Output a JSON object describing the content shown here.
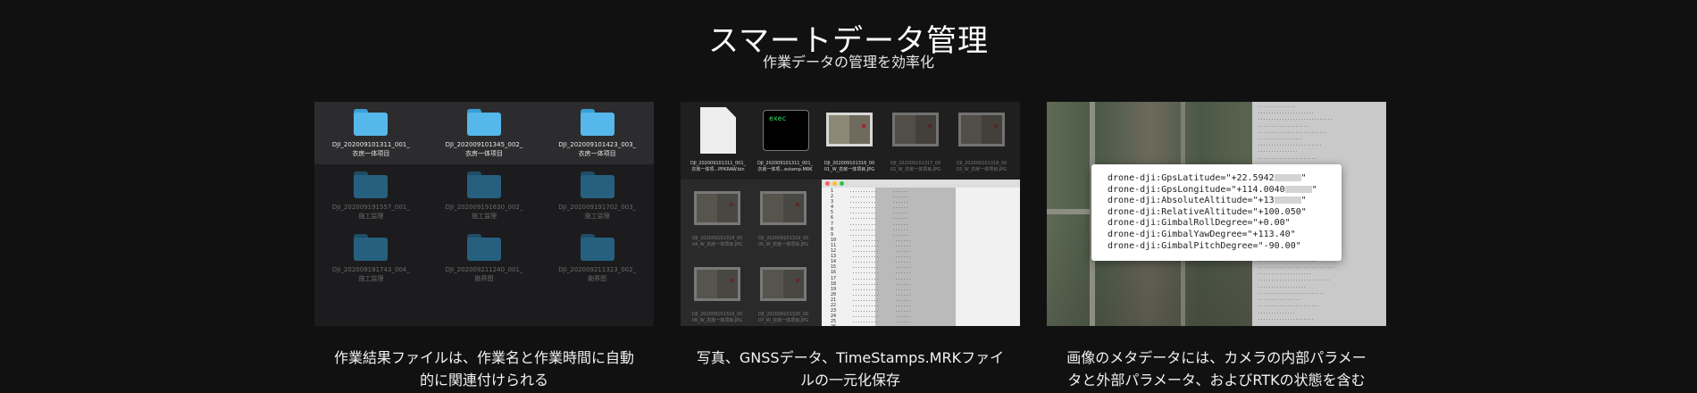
{
  "header": {
    "title": "スマートデータ管理",
    "subtitle": "作業データの管理を効率化"
  },
  "features": [
    {
      "caption_line1": "作業結果ファイルは、作業名と作業時間に自動",
      "caption_line2": "的に関連付けられる",
      "folders": [
        {
          "name1": "DJI_202009101311_001_",
          "name2": "衣房一体项目"
        },
        {
          "name1": "DJI_202009101345_002_",
          "name2": "衣房一体项目"
        },
        {
          "name1": "DJI_202009101423_003_",
          "name2": "衣房一体项目"
        },
        {
          "name1": "DJI_202009191557_001_",
          "name2": "施工监理"
        },
        {
          "name1": "DJI_202009191630_002_",
          "name2": "施工监理"
        },
        {
          "name1": "DJI_202009191702_003_",
          "name2": "施工监理"
        },
        {
          "name1": "DJI_202009191743_004_",
          "name2": "施工监理"
        },
        {
          "name1": "DJI_202009211240_001_",
          "name2": "勘界图"
        },
        {
          "name1": "DJI_202009211323_002_",
          "name2": "勘界图"
        }
      ]
    },
    {
      "caption_line1": "写真、GNSSデータ、TimeStamps.MRKファイ",
      "caption_line2": "ルの一元化保存",
      "exec_label": "exec",
      "files": [
        {
          "name1": "DJI_202009101311_001_",
          "name2": "衣房一体项...PPKRAW.bin"
        },
        {
          "name1": "DJI_202009101311_001_",
          "name2": "衣房一体项...estamp.MRK"
        },
        {
          "name1": "DJI_202009101316_00",
          "name2": "01_W_衣房一体项目.JPG"
        },
        {
          "name1": "DJI_202009101317_00",
          "name2": "02_W_衣房一体项目.JPG"
        },
        {
          "name1": "DJI_202009101318_00",
          "name2": "03_W_衣房一体项目.JPG"
        },
        {
          "name1": "DJI_202009101318_00",
          "name2": "04_W_衣房一体项目.JPG"
        },
        {
          "name1": "DJI_202009101319_00",
          "name2": "05_W_衣房一体项目.JPG"
        },
        {
          "name1": "DJI_202009101319_00",
          "name2": "06_W_衣房一体项目.JPG"
        },
        {
          "name1": "DJI_202009101320_00",
          "name2": "07_W_衣房一体项目.JPG"
        }
      ]
    },
    {
      "caption_line1": "画像のメタデータには、カメラの内部パラメー",
      "caption_line2": "タと外部パラメータ、およびRTKの状態を含む",
      "metadata": [
        {
          "pre": "drone-dji:GpsLatitude=\"+22.5942",
          "post": "\""
        },
        {
          "pre": "drone-dji:GpsLongitude=\"+114.0040",
          "post": "\""
        },
        {
          "pre": "drone-dji:AbsoluteAltitude=\"+13",
          "post": "\""
        },
        {
          "pre": "drone-dji:RelativeAltitude=\"+100.050\"",
          "post": ""
        },
        {
          "pre": "drone-dji:GimbalRollDegree=\"+0.00\"",
          "post": ""
        },
        {
          "pre": "drone-dji:GimbalYawDegree=\"+113.40\"",
          "post": ""
        },
        {
          "pre": "drone-dji:GimbalPitchDegree=\"-90.00\"",
          "post": ""
        }
      ]
    }
  ]
}
